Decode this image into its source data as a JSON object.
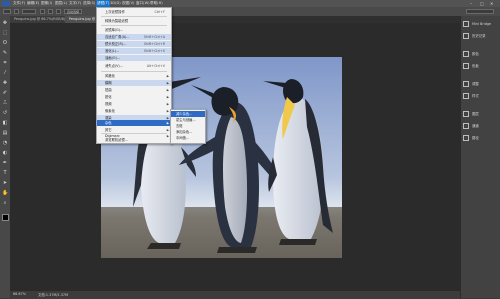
{
  "menubar": {
    "items": [
      "文件(F)",
      "编辑(E)",
      "图像(I)",
      "图层(L)",
      "文字(Y)",
      "选择(S)",
      "滤镜(T)",
      "3D(D)",
      "视图(V)",
      "窗口(W)",
      "帮助(H)"
    ],
    "active_index": 6
  },
  "options_bar": {
    "preset": "自动选择"
  },
  "document_tabs": [
    "Penguins.jpg @ 66.7%(RGB/8)",
    "Penguins.jpg @ 66.7%(RGB/8)"
  ],
  "status": {
    "zoom": "66.67%",
    "doc": "文档:1.37M/1.37M"
  },
  "filter_menu": {
    "items": [
      {
        "label": "上次滤镜操作",
        "shortcut": "Ctrl+F"
      },
      {
        "label": "转换为智能滤镜"
      },
      {
        "label": "滤镜库(G)..."
      },
      {
        "label": "自适应广角(A)...",
        "shortcut": "Shift+Ctrl+A"
      },
      {
        "label": "镜头校正(R)...",
        "shortcut": "Shift+Ctrl+R"
      },
      {
        "label": "液化(L)...",
        "shortcut": "Shift+Ctrl+X"
      },
      {
        "label": "油画(O)..."
      },
      {
        "label": "消失点(V)...",
        "shortcut": "Alt+Ctrl+V"
      },
      {
        "label": "风格化",
        "submenu": true
      },
      {
        "label": "模糊",
        "submenu": true
      },
      {
        "label": "扭曲",
        "submenu": true
      },
      {
        "label": "锐化",
        "submenu": true
      },
      {
        "label": "视频",
        "submenu": true
      },
      {
        "label": "像素化",
        "submenu": true
      },
      {
        "label": "渲染",
        "submenu": true
      },
      {
        "label": "杂色",
        "submenu": true
      },
      {
        "label": "其它",
        "submenu": true
      },
      {
        "label": "Digimarc",
        "submenu": true
      },
      {
        "label": "浏览联机滤镜..."
      }
    ]
  },
  "noise_submenu": {
    "items": [
      "减少杂色...",
      "蒙尘与划痕...",
      "去斑",
      "添加杂色...",
      "中间值..."
    ]
  },
  "right_panel": {
    "items": [
      "Mini Bridge",
      "历史记录",
      "颜色",
      "色板",
      "调整",
      "样式",
      "图层",
      "通道",
      "路径"
    ]
  },
  "colors": {
    "menu_highlight": "#2d6bc4",
    "ui_dark": "#3a3a3a",
    "sky": "#9fb3d6"
  }
}
